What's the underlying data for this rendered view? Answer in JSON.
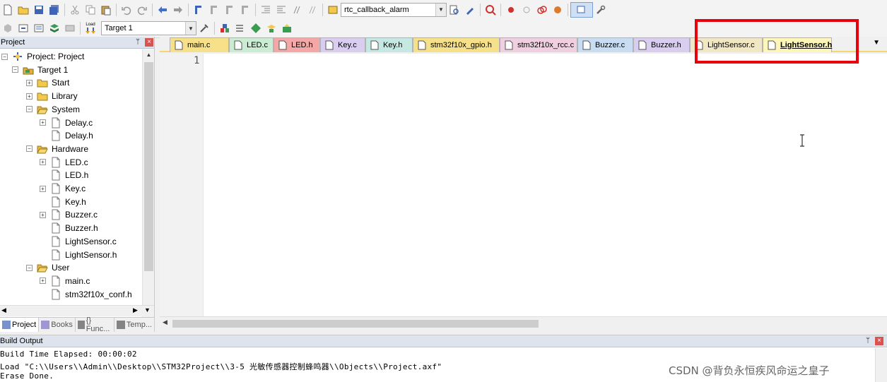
{
  "toolbar1": {
    "target_combo": "rtc_callback_alarm"
  },
  "toolbar2": {
    "load_label": "Load",
    "target_combo": "Target 1"
  },
  "project_panel": {
    "title": "Project",
    "tree": [
      {
        "label": "Project: Project",
        "kind": "project",
        "depth": 0,
        "expander": "minus"
      },
      {
        "label": "Target 1",
        "kind": "target",
        "depth": 1,
        "expander": "minus"
      },
      {
        "label": "Start",
        "kind": "folder",
        "depth": 2,
        "expander": "plus"
      },
      {
        "label": "Library",
        "kind": "folder",
        "depth": 2,
        "expander": "plus"
      },
      {
        "label": "System",
        "kind": "folder-open",
        "depth": 2,
        "expander": "minus"
      },
      {
        "label": "Delay.c",
        "kind": "file",
        "depth": 3,
        "expander": "plus"
      },
      {
        "label": "Delay.h",
        "kind": "file",
        "depth": 3,
        "expander": "none"
      },
      {
        "label": "Hardware",
        "kind": "folder-open",
        "depth": 2,
        "expander": "minus"
      },
      {
        "label": "LED.c",
        "kind": "file",
        "depth": 3,
        "expander": "plus"
      },
      {
        "label": "LED.h",
        "kind": "file",
        "depth": 3,
        "expander": "none"
      },
      {
        "label": "Key.c",
        "kind": "file",
        "depth": 3,
        "expander": "plus"
      },
      {
        "label": "Key.h",
        "kind": "file",
        "depth": 3,
        "expander": "none"
      },
      {
        "label": "Buzzer.c",
        "kind": "file",
        "depth": 3,
        "expander": "plus"
      },
      {
        "label": "Buzzer.h",
        "kind": "file",
        "depth": 3,
        "expander": "none"
      },
      {
        "label": "LightSensor.c",
        "kind": "file",
        "depth": 3,
        "expander": "none"
      },
      {
        "label": "LightSensor.h",
        "kind": "file",
        "depth": 3,
        "expander": "none"
      },
      {
        "label": "User",
        "kind": "folder-open",
        "depth": 2,
        "expander": "minus"
      },
      {
        "label": "main.c",
        "kind": "file",
        "depth": 3,
        "expander": "plus"
      },
      {
        "label": "stm32f10x_conf.h",
        "kind": "file",
        "depth": 3,
        "expander": "none"
      }
    ],
    "tabs": [
      {
        "label": "Project",
        "active": true
      },
      {
        "label": "Books",
        "active": false
      },
      {
        "label": "{} Func...",
        "active": false
      },
      {
        "label": "Temp...",
        "active": false
      }
    ]
  },
  "editor": {
    "tabs": [
      {
        "label": "main.c",
        "color": "#f7e08a",
        "active": false
      },
      {
        "label": "LED.c",
        "color": "#c9ecd2",
        "active": false
      },
      {
        "label": "LED.h",
        "color": "#f4a7a7",
        "active": false
      },
      {
        "label": "Key.c",
        "color": "#d9cdf0",
        "active": false
      },
      {
        "label": "Key.h",
        "color": "#c5e8e2",
        "active": false
      },
      {
        "label": "stm32f10x_gpio.h",
        "color": "#f7e08a",
        "active": false
      },
      {
        "label": "stm32f10x_rcc.c",
        "color": "#f0cfe0",
        "active": false
      },
      {
        "label": "Buzzer.c",
        "color": "#c8dcf2",
        "active": false
      },
      {
        "label": "Buzzer.h",
        "color": "#d9cdf0",
        "active": false
      },
      {
        "label": "LightSensor.c",
        "color": "#f1e7c4",
        "active": false
      },
      {
        "label": "LightSensor.h",
        "color": "#fdf6b8",
        "active": true
      }
    ],
    "line_number": "1"
  },
  "build_output": {
    "title": "Build Output",
    "lines": [
      "Build Time Elapsed:  00:00:02",
      "Load \"C:\\\\Users\\\\Admin\\\\Desktop\\\\STM32Project\\\\3-5 光敏传感器控制蜂鸣器\\\\Objects\\\\Project.axf\"",
      "Erase Done."
    ]
  },
  "watermark": "CSDN @背负永恒疾风命运之皇子",
  "colors": {
    "highlight_box": "#e8000a",
    "active_tab_underline": "#f5d76e",
    "panel_title_bg": "#dde4ee"
  }
}
